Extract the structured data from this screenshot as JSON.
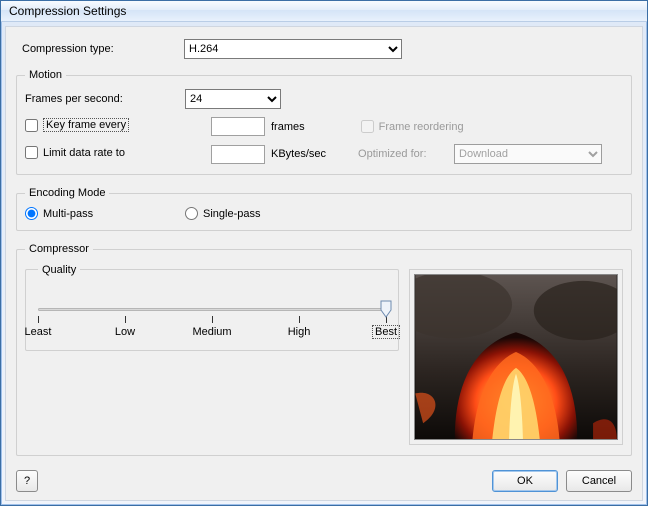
{
  "window": {
    "title": "Compression Settings"
  },
  "compression_type": {
    "label": "Compression type:",
    "value": "H.264"
  },
  "motion": {
    "legend": "Motion",
    "fps_label": "Frames per second:",
    "fps_value": "24",
    "keyframe_label": "Key frame every",
    "keyframe_value": "",
    "keyframe_unit": "frames",
    "frame_reordering_label": "Frame reordering",
    "limit_label": "Limit data rate to",
    "limit_value": "",
    "limit_unit": "KBytes/sec",
    "optimized_label": "Optimized for:",
    "optimized_value": "Download"
  },
  "encoding": {
    "legend": "Encoding Mode",
    "multi": "Multi-pass",
    "single": "Single-pass",
    "selected": "multi"
  },
  "compressor": {
    "legend": "Compressor",
    "quality_legend": "Quality",
    "ticks": [
      "Least",
      "Low",
      "Medium",
      "High",
      "Best"
    ],
    "value_index": 4
  },
  "footer": {
    "help": "?",
    "ok": "OK",
    "cancel": "Cancel"
  },
  "colors": {
    "accent": "#4f93d6"
  }
}
